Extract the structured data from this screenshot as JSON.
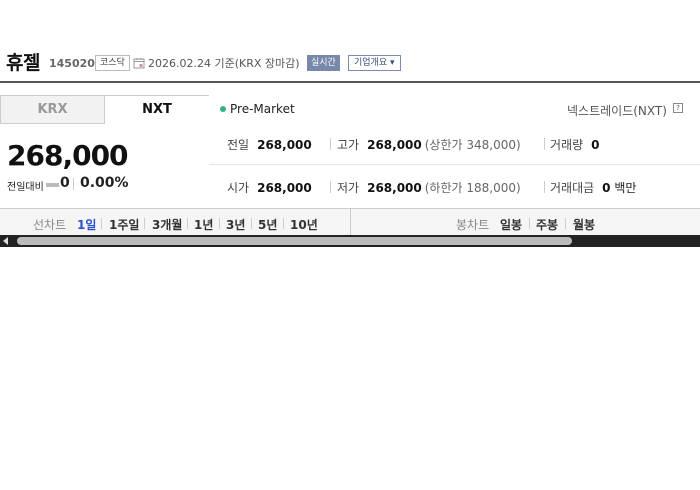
{
  "header": {
    "company_name": "휴젤",
    "stock_code": "145020",
    "market": "코스닥",
    "base_date": "2026.02.24 기준(KRX 장마감)",
    "realtime_label": "실시간",
    "overview_label": "기업개요",
    "overview_icon": "chevron-down-icon",
    "date_icon": "calendar-icon"
  },
  "tabs": [
    {
      "label": "KRX",
      "active": false
    },
    {
      "label": "NXT",
      "active": true
    }
  ],
  "session": {
    "status": "Pre-Market",
    "status_color": "#2fb38f",
    "exchange_label": "넥스트레이드(NXT)",
    "help_symbol": "?"
  },
  "price": {
    "current": "268,000",
    "change_label": "전일대비",
    "change_value": "0",
    "change_rate": "0.00%"
  },
  "stats": {
    "prev_close": {
      "label": "전일",
      "value": "268,000"
    },
    "high": {
      "label": "고가",
      "value": "268,000",
      "sub": "(상한가 348,000)"
    },
    "volume": {
      "label": "거래량",
      "value": "0"
    },
    "open": {
      "label": "시가",
      "value": "268,000"
    },
    "low": {
      "label": "저가",
      "value": "268,000",
      "sub": "(하한가 188,000)"
    },
    "trade_value": {
      "label": "거래대금",
      "value": "0",
      "unit": "백만"
    }
  },
  "line_chart": {
    "title": "선차트",
    "periods": [
      "1일",
      "1주일",
      "3개월",
      "1년",
      "3년",
      "5년",
      "10년"
    ],
    "active": "1일",
    "active_color": "#2a54c8"
  },
  "candle_chart": {
    "title": "봉차트",
    "periods": [
      "일봉",
      "주봉",
      "월봉"
    ]
  }
}
